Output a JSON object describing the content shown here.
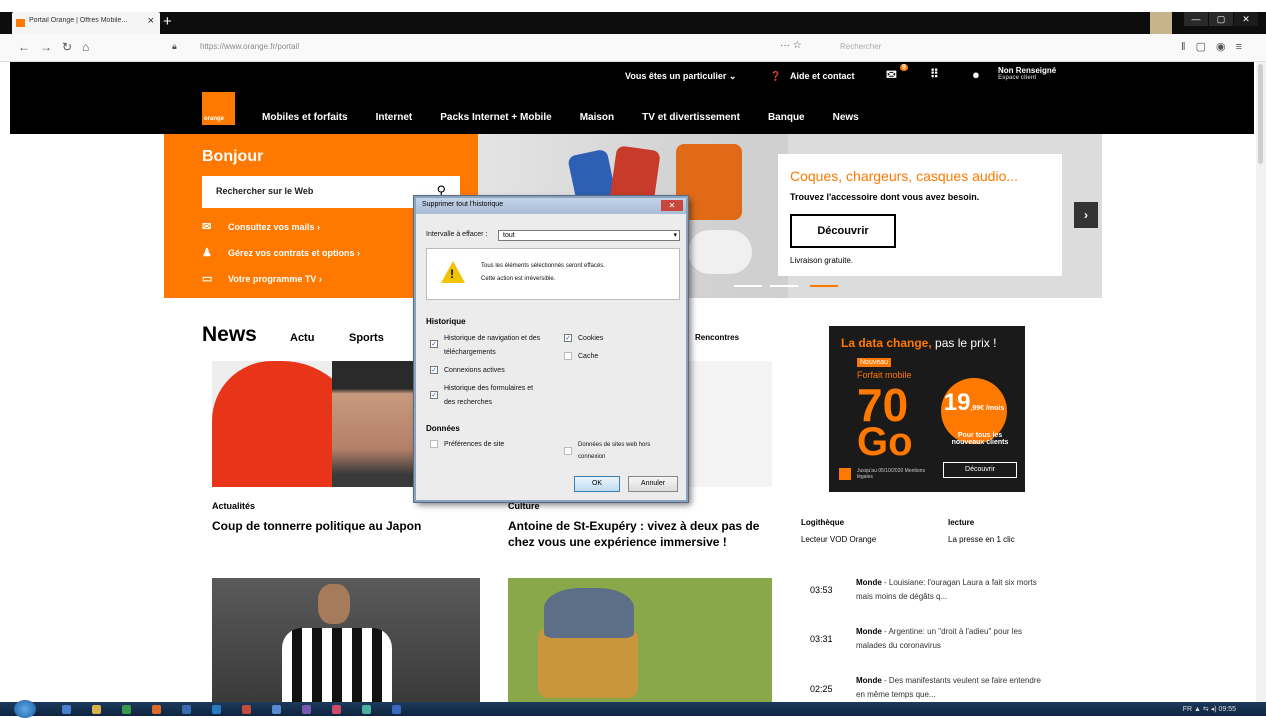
{
  "browser": {
    "tab_title": "Portail Orange | Offres Mobile...",
    "tab_close": "×",
    "new_tab": "+",
    "url": "https://www.orange.fr/portail",
    "search_placeholder": "Rechercher",
    "win_min": "—",
    "win_max": "▢",
    "win_close": "✕"
  },
  "site_header": {
    "particulier": "Vous êtes un particulier ⌄",
    "aide": "Aide et contact",
    "mail_badge": "9",
    "user_name": "Non Renseigné",
    "user_sub": "Espace client",
    "logo": "orange",
    "nav": [
      "Mobiles et forfaits",
      "Internet",
      "Packs Internet + Mobile",
      "Maison",
      "TV et divertissement",
      "Banque",
      "News"
    ]
  },
  "hero": {
    "greeting": "Bonjour",
    "search_placeholder": "Rechercher sur le Web",
    "links": [
      "Consultez vos mails ›",
      "Gérez vos contrats et options ›",
      "Votre programme TV ›"
    ],
    "promo_title": "Coques, chargeurs, casques audio...",
    "promo_sub": "Trouvez l'accessoire dont vous avez besoin.",
    "promo_button": "Découvrir",
    "promo_note": "Livraison gratuite."
  },
  "news": {
    "title": "News",
    "tabs": [
      "Actu",
      "Sports"
    ],
    "rencontres": "Rencontres",
    "articles": [
      {
        "category": "Actualités",
        "headline": "Coup de tonnerre politique au Japon"
      },
      {
        "category": "Culture",
        "headline": "Antoine de St-Exupéry : vivez à deux pas de chez vous une expérience immersive !"
      }
    ]
  },
  "ad": {
    "line1_a": "La data change,",
    "line1_b": " pas le prix !",
    "tag": "Nouveau",
    "forfait": "Forfait mobile",
    "big1": "70",
    "big2": "Go",
    "price": "19",
    "price_suffix": ",99€ /mois",
    "side": "Pour tous les nouveaux clients",
    "button": "Découvrir",
    "fine": "Jusqu'au 05/10/2020 Mentions légales"
  },
  "side_links": {
    "cat1": "Logithèque",
    "link1": "Lecteur VOD Orange",
    "cat2": "lecture",
    "link2": "La presse en 1 clic"
  },
  "feed": [
    {
      "time": "03:53",
      "section": "Monde",
      "text": " - Louisiane: l'ouragan Laura a fait six morts mais moins de dégâts q..."
    },
    {
      "time": "03:31",
      "section": "Monde",
      "text": " - Argentine: un \"droit à l'adieu\" pour les malades du coronavirus"
    },
    {
      "time": "02:25",
      "section": "Monde",
      "text": " - Des manifestants veulent se faire entendre en même temps que..."
    }
  ],
  "dialog": {
    "title": "Supprimer tout l'historique",
    "close": "✕",
    "range_label": "Intervalle à effacer :",
    "range_value": "tout",
    "warn_line1": "Tous les éléments sélectionnés seront effacés.",
    "warn_line2": "Cette action est irréversible.",
    "history_heading": "Historique",
    "cb_nav_1": "Historique de navigation et des",
    "cb_nav_2": "téléchargements",
    "cb_cookies": "Cookies",
    "cb_cache": "Cache",
    "cb_connexions": "Connexions actives",
    "cb_forms_1": "Historique des formulaires et",
    "cb_forms_2": "des recherches",
    "data_heading": "Données",
    "cb_prefs": "Préférences de site",
    "cb_offline_1": "Données de sites web hors",
    "cb_offline_2": "connexion",
    "ok": "OK",
    "cancel": "Annuler",
    "check": "✓"
  },
  "taskbar": {
    "tray": "FR  ▲  ⇆  ◂)    09:55"
  },
  "colors": {
    "orange": "#ff7900",
    "black": "#000000"
  }
}
